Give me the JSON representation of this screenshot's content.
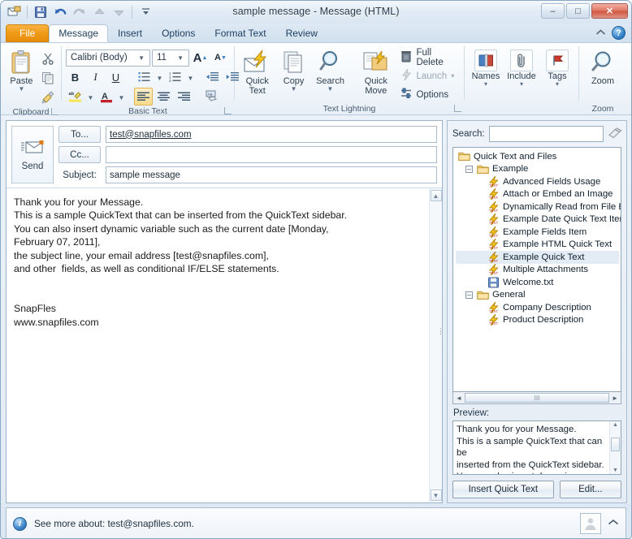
{
  "window": {
    "title": "sample message  -  Message (HTML)",
    "quick_access": [
      {
        "name": "envelope-icon",
        "label": "Message"
      },
      {
        "name": "save-icon",
        "label": "Save"
      },
      {
        "name": "undo-icon",
        "label": "Undo"
      },
      {
        "name": "redo-icon",
        "label": "Redo"
      },
      {
        "name": "previous-item-icon",
        "label": "Previous Item"
      },
      {
        "name": "next-item-icon",
        "label": "Next Item"
      },
      {
        "name": "customize-qat-icon",
        "label": "Customize Quick Access Toolbar"
      }
    ],
    "controls": {
      "minimize": "–",
      "maximize": "□",
      "close": "✕"
    }
  },
  "tabs": {
    "file": "File",
    "items": [
      "Message",
      "Insert",
      "Options",
      "Format Text",
      "Review"
    ],
    "active": "Message",
    "collapse_ribbon_icon": "chevron-up-icon",
    "help_label": "?"
  },
  "ribbon": {
    "groups": [
      {
        "name": "clipboard",
        "label": "Clipboard",
        "big": {
          "label_line1": "Paste",
          "label_line2": "",
          "caret": "▼"
        },
        "small": [
          {
            "name": "cut-icon",
            "label": "Cut"
          },
          {
            "name": "copy-icon",
            "label": "Copy"
          },
          {
            "name": "format-painter-icon",
            "label": "Format Painter"
          }
        ]
      },
      {
        "name": "basic-text",
        "label": "Basic Text",
        "font_name": "Calibri (Body)",
        "font_size": "11",
        "buttons": {
          "grow_font": "A",
          "shrink_font": "A",
          "bold": "B",
          "italic": "I",
          "underline": "U",
          "bullets": "bullet-list-icon",
          "numbering": "numbered-list-icon",
          "decrease_indent": "decrease-indent-icon",
          "increase_indent": "increase-indent-icon",
          "highlight": "text-highlight-icon",
          "font_color": "A",
          "align_left": "align-left-icon",
          "align_center": "align-center-icon",
          "align_right": "align-right-icon",
          "clear_formatting": "clear-formatting-icon"
        }
      },
      {
        "name": "text-lightning",
        "label": "Text Lightning",
        "big_buttons": [
          {
            "line1": "Quick",
            "line2": "Text",
            "icon": "quick-text-icon",
            "caret": ""
          },
          {
            "line1": "Copy",
            "line2": "",
            "icon": "copy-pages-icon",
            "caret": "▼"
          },
          {
            "line1": "Search",
            "line2": "",
            "icon": "search-magnifier-icon",
            "caret": "▼"
          },
          {
            "line1": "Quick",
            "line2": "Move",
            "icon": "quick-move-icon",
            "caret": ""
          }
        ],
        "small_items": [
          {
            "label": "Full Delete",
            "icon": "trash-icon",
            "disabled": false
          },
          {
            "label": "Launch",
            "icon": "launch-icon",
            "disabled": true,
            "caret": "▾"
          },
          {
            "label": "Options",
            "icon": "options-icon",
            "disabled": false
          }
        ]
      },
      {
        "name": "names-include-tags",
        "label": "",
        "boxes": [
          {
            "label": "Names",
            "icon": "address-book-icon",
            "caret": "▾"
          },
          {
            "label": "Include",
            "icon": "paperclip-icon",
            "caret": "▾"
          },
          {
            "label": "Tags",
            "icon": "flag-icon",
            "caret": "▾"
          }
        ]
      },
      {
        "name": "zoom",
        "label": "Zoom",
        "big": {
          "label_line1": "Zoom",
          "icon": "zoom-magnifier-icon"
        }
      }
    ]
  },
  "compose": {
    "send_label": "Send",
    "send_icon": "send-envelope-icon",
    "to_label": "To...",
    "to_value": "test@snapfiles.com",
    "cc_label": "Cc...",
    "cc_value": "",
    "subject_label": "Subject:",
    "subject_value": "sample message",
    "body": "Thank you for your Message.\nThis is a sample QuickText that can be inserted from the QuickText sidebar.\nYou can also insert dynamic variable such as the current date [Monday,\nFebruary 07, 2011],\nthe subject line, your email address [test@snapfiles.com],\nand other  fields, as well as conditional IF/ELSE statements.\n\n\nSnapFles\nwww.snapfiles.com",
    "scroll_up": "▲",
    "scroll_down": "▼"
  },
  "sidebar": {
    "search_label": "Search:",
    "search_value": "",
    "search_placeholder": "",
    "clear_icon": "eraser-icon",
    "tree": [
      {
        "level": 0,
        "label": "Quick Text and Files",
        "icon": "folder-icon",
        "toggle": "",
        "selected": false
      },
      {
        "level": 1,
        "label": "Example",
        "icon": "folder-icon",
        "toggle": "–",
        "selected": false
      },
      {
        "level": 2,
        "label": "Advanced Fields Usage",
        "icon": "quicktext-icon",
        "toggle": "",
        "selected": false
      },
      {
        "level": 2,
        "label": "Attach or Embed an Image",
        "icon": "quicktext-icon",
        "toggle": "",
        "selected": false
      },
      {
        "level": 2,
        "label": "Dynamically Read from File Exam",
        "icon": "quicktext-icon",
        "toggle": "",
        "selected": false
      },
      {
        "level": 2,
        "label": "Example Date Quick Text Item",
        "icon": "quicktext-icon",
        "toggle": "",
        "selected": false
      },
      {
        "level": 2,
        "label": "Example Fields Item",
        "icon": "quicktext-icon",
        "toggle": "",
        "selected": false
      },
      {
        "level": 2,
        "label": "Example HTML Quick Text",
        "icon": "quicktext-icon",
        "toggle": "",
        "selected": false
      },
      {
        "level": 2,
        "label": "Example Quick Text",
        "icon": "quicktext-icon",
        "toggle": "",
        "selected": true
      },
      {
        "level": 2,
        "label": "Multiple Attachments",
        "icon": "quicktext-icon",
        "toggle": "",
        "selected": false
      },
      {
        "level": 2,
        "label": "Welcome.txt",
        "icon": "file-txt-icon",
        "toggle": "",
        "selected": false
      },
      {
        "level": 1,
        "label": "General",
        "icon": "folder-icon",
        "toggle": "–",
        "selected": false
      },
      {
        "level": 2,
        "label": "Company Description",
        "icon": "quicktext-icon",
        "toggle": "",
        "selected": false
      },
      {
        "level": 2,
        "label": "Product Description",
        "icon": "quicktext-icon",
        "toggle": "",
        "selected": false
      }
    ],
    "hscroll": {
      "left": "◄",
      "right": "►",
      "grip": "III"
    },
    "preview_label": "Preview:",
    "preview_text": "Thank you for your Message.\nThis is a sample QuickText that can be\ninserted from the QuickText sidebar.\nYou can also insert dynamic variable",
    "preview_up": "▲",
    "preview_down": "▼",
    "insert_button": "Insert Quick Text",
    "edit_button": "Edit..."
  },
  "status": {
    "info_icon": "info-icon",
    "text": "See more about: test@snapfiles.com.",
    "avatar_icon": "contact-avatar-icon",
    "expand_icon": "chevron-up-icon"
  }
}
